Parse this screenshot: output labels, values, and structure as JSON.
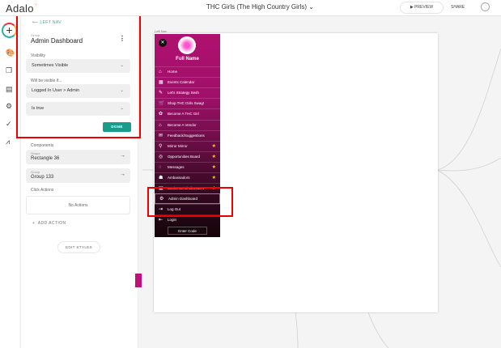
{
  "header": {
    "logo": "Adalo",
    "app_title": "THC Girls (The High Country Girls)",
    "preview": "PREVIEW",
    "share": "SHARE"
  },
  "panel": {
    "back": "LEFT NAV",
    "type": "Group",
    "name": "Admin Dashboard",
    "visibility_label": "Visibility",
    "visibility": "Sometimes Visible",
    "condition_label": "Will be visible if...",
    "condition": "Logged In User > Admin",
    "operator": "Is true",
    "done": "DONE",
    "components_label": "Components",
    "components": [
      {
        "type": "Shape",
        "name": "Rectangle 36"
      },
      {
        "type": "Group",
        "name": "Group 133"
      }
    ],
    "click_actions_label": "Click Actions",
    "no_actions": "No Actions",
    "add_action": "ADD ACTION",
    "edit_styles": "EDIT STYLES"
  },
  "canvas": {
    "screen_label": "Left Nav",
    "full_name": "Full Name",
    "enter_code": "Enter Code",
    "menu": [
      {
        "label": "Home",
        "icon": "⌂"
      },
      {
        "label": "Events Calendar",
        "icon": "▦"
      },
      {
        "label": "Let's Strategy Sesh",
        "icon": "✎"
      },
      {
        "label": "Shop THC Girls Swag!",
        "icon": "🛒"
      },
      {
        "label": "Become A THC Girl",
        "icon": "✿"
      },
      {
        "label": "Become A Vendor",
        "icon": "⌂"
      },
      {
        "label": "Feedback/Suggestions",
        "icon": "✉"
      },
      {
        "label": "Mirror Mirror",
        "icon": "⚲",
        "star": true
      },
      {
        "label": "Opportunities Board",
        "icon": "◎",
        "star": true
      },
      {
        "label": "Messages",
        "icon": "◌",
        "star": true
      },
      {
        "label": "Ambassadors",
        "icon": "☗",
        "star": true
      },
      {
        "label": "Businesses/Advocates",
        "icon": "▣",
        "star": true
      },
      {
        "label": "Admin Dashboard",
        "icon": "⚙"
      },
      {
        "label": "Log Out",
        "icon": "⇥"
      },
      {
        "label": "Login",
        "icon": "⇤"
      }
    ]
  }
}
